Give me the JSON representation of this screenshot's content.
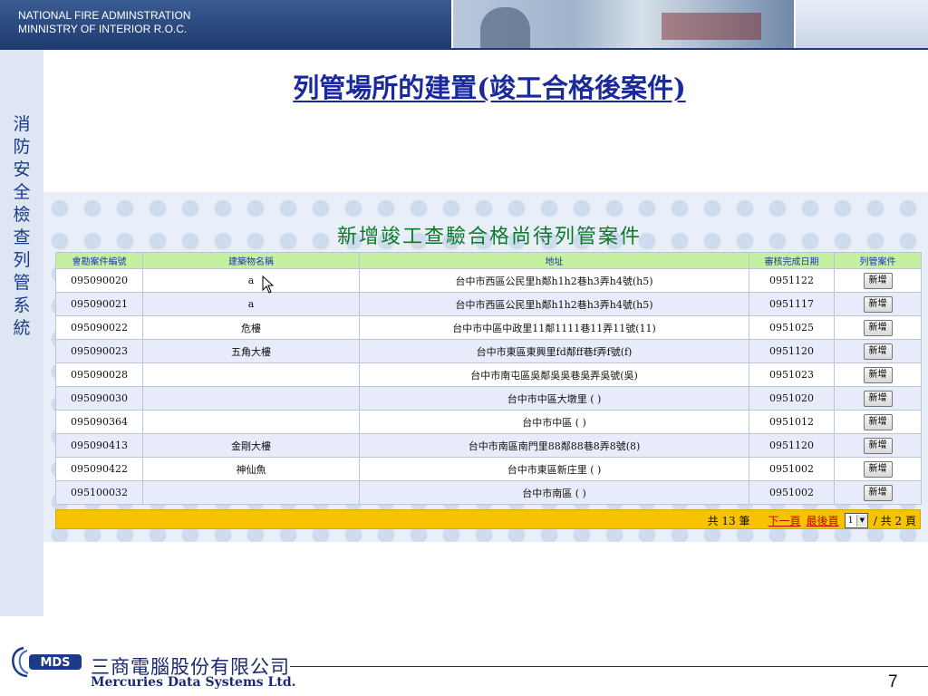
{
  "header": {
    "org_line1": "NATIONAL FIRE ADMINSTRATION",
    "org_line2": "MINNISTRY OF INTERIOR R.O.C."
  },
  "sidebar": {
    "vertical_title": "消防安全檢查列管系統"
  },
  "page": {
    "title": "列管場所的建置(竣工合格後案件)",
    "subtitle": "新增竣工查驗合格尚待列管案件"
  },
  "table": {
    "columns": [
      "會勘案件編號",
      "建築物名稱",
      "地址",
      "審核完成日期",
      "列管案件"
    ],
    "rows": [
      {
        "id": "095090020",
        "name": "a",
        "address": "台中市西區公民里h鄰h1h2巷h3弄h4號(h5)",
        "date": "0951122",
        "action": "新增"
      },
      {
        "id": "095090021",
        "name": "a",
        "address": "台中市西區公民里h鄰h1h2巷h3弄h4號(h5)",
        "date": "0951117",
        "action": "新增"
      },
      {
        "id": "095090022",
        "name": "危樓",
        "address": "台中市中區中政里11鄰1111巷11弄11號(11)",
        "date": "0951025",
        "action": "新增"
      },
      {
        "id": "095090023",
        "name": "五角大樓",
        "address": "台中市東區東興里fd鄰ff巷f弄f號(f)",
        "date": "0951120",
        "action": "新增"
      },
      {
        "id": "095090028",
        "name": "",
        "address": "台中市南屯區吳鄰吳吳巷吳弄吳號(吳)",
        "date": "0951023",
        "action": "新增"
      },
      {
        "id": "095090030",
        "name": "",
        "address": "台中市中區大墩里 ( )",
        "date": "0951020",
        "action": "新增"
      },
      {
        "id": "095090364",
        "name": "",
        "address": "台中市中區 ( )",
        "date": "0951012",
        "action": "新增"
      },
      {
        "id": "095090413",
        "name": "金剛大樓",
        "address": "台中市南區南門里88鄰88巷8弄8號(8)",
        "date": "0951120",
        "action": "新增"
      },
      {
        "id": "095090422",
        "name": "神仙魚",
        "address": "台中市東區新庄里 ( )",
        "date": "0951002",
        "action": "新增"
      },
      {
        "id": "095100032",
        "name": "",
        "address": "台中市南區 ( )",
        "date": "0951002",
        "action": "新增"
      }
    ]
  },
  "pagination": {
    "total_text": "共 13 筆",
    "next_label": "下一頁",
    "last_label": "最後頁",
    "current_page": "1",
    "total_pages_text": "/ 共 2 頁"
  },
  "footer": {
    "company_zh": "三商電腦股份有限公司",
    "company_en": "Mercuries Data Systems Ltd.",
    "slide_number": "7"
  },
  "icons": {
    "cursor": "mouse-pointer-icon",
    "dropdown": "chevron-down-icon",
    "logo": "mds-logo-icon"
  },
  "colors": {
    "header_blue": "#1e3a6e",
    "title_blue": "#1a2a9c",
    "subtitle_green": "#0e7a28",
    "table_header": "#c6ef9f",
    "pager_bar": "#f7c200"
  }
}
